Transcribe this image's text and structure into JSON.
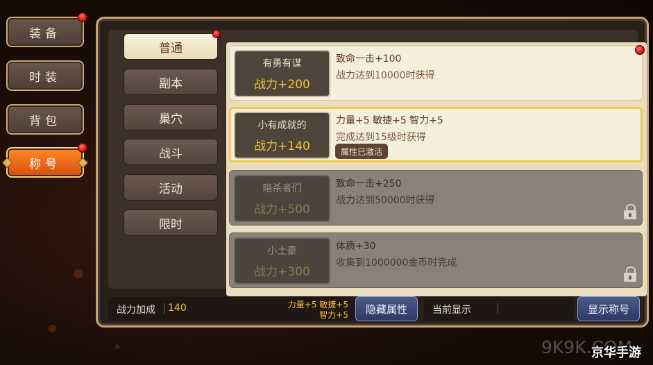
{
  "side_tabs": [
    "装备",
    "时装",
    "背包",
    "称号"
  ],
  "categories": [
    "普通",
    "副本",
    "巢穴",
    "战斗",
    "活动",
    "限时"
  ],
  "titles": [
    {
      "name": "有勇有谋",
      "power": "战力+200",
      "attr": "致命一击+100",
      "cond": "战力达到10000时获得",
      "state": "normal"
    },
    {
      "name": "小有成就的",
      "power": "战力+140",
      "attr": "力量+5    敏捷+5    智力+5",
      "cond": "完成达到15级时获得",
      "status": "属性已激活",
      "state": "active"
    },
    {
      "name": "暗杀者们",
      "power": "战力+500",
      "attr": "致命一击+250",
      "cond": "战力达到50000时获得",
      "state": "locked"
    },
    {
      "name": "小土豪",
      "power": "战力+300",
      "attr": "体质+30",
      "cond": "收集到1000000金币时完成",
      "state": "locked"
    }
  ],
  "bonus": {
    "label": "战力加成",
    "value": "140",
    "stats_line1": "力量+5  敏捷+5",
    "stats_line2": "智力+5"
  },
  "buttons": {
    "hide": "隐藏属性",
    "current_label": "当前显示",
    "show": "显示称号"
  },
  "watermark": {
    "text1": "9K9K.COM",
    "text2": "京华手游"
  },
  "colors": {
    "accent": "#f3c23a",
    "active_tab": "#e8661a",
    "notify": "#d41010"
  }
}
